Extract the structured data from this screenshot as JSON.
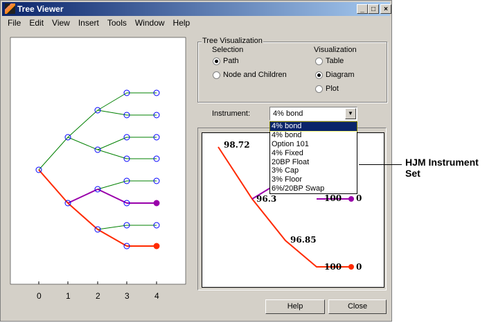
{
  "window": {
    "title": "Tree Viewer",
    "minimize": "_",
    "maximize": "□",
    "close": "×"
  },
  "menu": [
    "File",
    "Edit",
    "View",
    "Insert",
    "Tools",
    "Window",
    "Help"
  ],
  "tree_axis": [
    "0",
    "1",
    "2",
    "3",
    "4"
  ],
  "tree_viz": {
    "title": "Tree Visualization",
    "selection_label": "Selection",
    "selection_options": [
      {
        "label": "Path",
        "checked": true
      },
      {
        "label": "Node and Children",
        "checked": false
      }
    ],
    "visualization_label": "Visualization",
    "visualization_options": [
      {
        "label": "Table",
        "checked": false
      },
      {
        "label": "Diagram",
        "checked": true
      },
      {
        "label": "Plot",
        "checked": false
      }
    ]
  },
  "instrument": {
    "label": "Instrument:",
    "value": "4% bond",
    "options": [
      "4% bond",
      "4% bond",
      "Option 101",
      "4% Fixed",
      "20BP Float",
      "3% Cap",
      "3% Floor",
      "6%/20BP Swap"
    ],
    "selected_index": 0
  },
  "diagram_labels": {
    "root": "98.72",
    "n1": "96.3",
    "n2": "96.85",
    "p_end": "100",
    "p_zero": "0",
    "r_end": "100",
    "r_zero": "0"
  },
  "buttons": {
    "help": "Help",
    "close": "Close"
  },
  "annotation": "HJM Instrument Set",
  "colors": {
    "path_red": "#ff2a00",
    "path_purple": "#9900aa",
    "edge_green": "#008000",
    "node_blue": "#0000ff"
  }
}
